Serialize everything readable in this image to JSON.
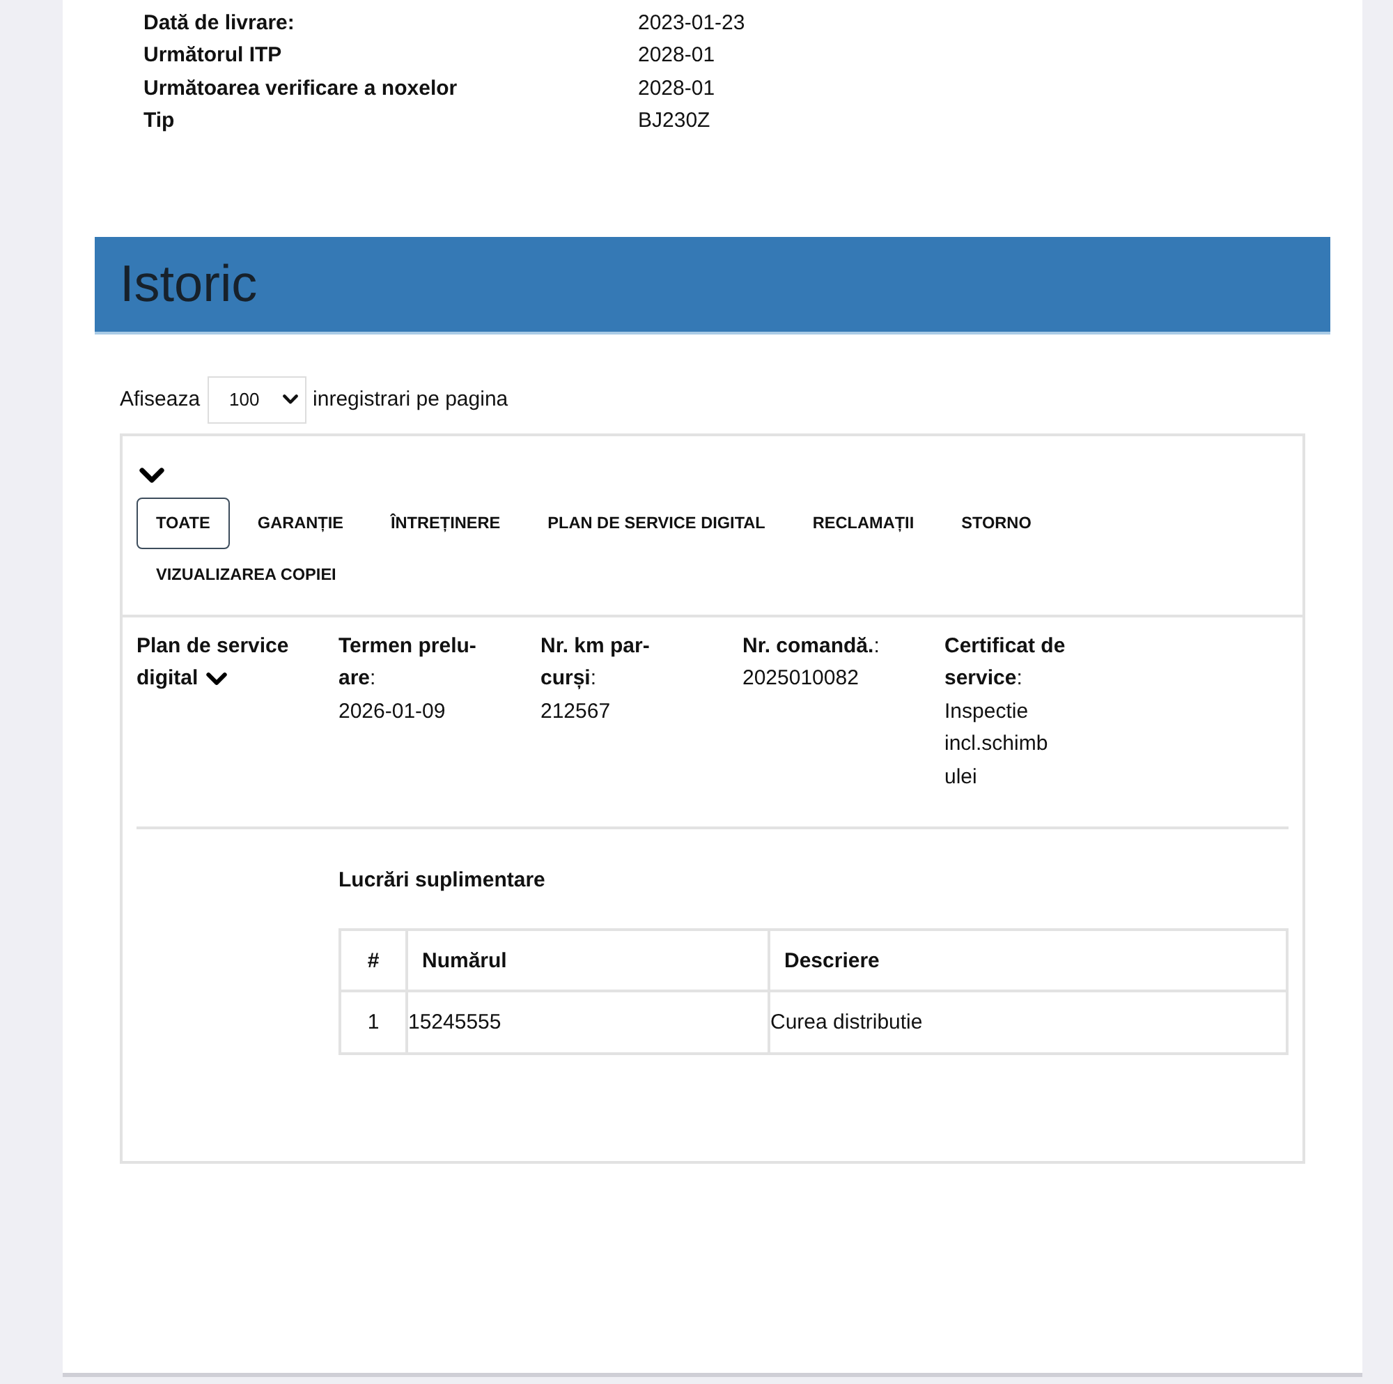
{
  "vehicle_info": [
    {
      "label": "Dată de livrare:",
      "value": "2023-01-23"
    },
    {
      "label": "Următorul ITP",
      "value": "2028-01"
    },
    {
      "label": "Următoarea verificare a noxelor",
      "value": "2028-01"
    },
    {
      "label": "Tip",
      "value": "BJ230Z"
    }
  ],
  "history": {
    "title": "Istoric",
    "page_size": {
      "prefix": "Afiseaza",
      "value": "100",
      "suffix": "inregistrari pe pagina"
    },
    "filter_tabs": [
      {
        "label": "TOATE",
        "selected": true
      },
      {
        "label": "GARANȚIE",
        "selected": false
      },
      {
        "label": "ÎNTREȚINERE",
        "selected": false
      },
      {
        "label": "PLAN DE SERVICE DIGITAL",
        "selected": false
      },
      {
        "label": "RECLAMAȚII",
        "selected": false
      },
      {
        "label": "STORNO",
        "selected": false
      },
      {
        "label": "VIZUALIZAREA COPIEI",
        "selected": false
      }
    ],
    "records": [
      {
        "type": "Plan de service digital",
        "expanded": true,
        "fields": [
          {
            "label": "**Termen prelu-are**:",
            "value": "2026-01-09"
          },
          {
            "label": "**Nr. km par-curși**:",
            "value": "212567"
          },
          {
            "label": "**Nr. comandă.**:",
            "value": "2025010082"
          },
          {
            "label": "**Certificat de service**:",
            "value": "Inspectie incl.schimb ulei"
          }
        ],
        "additional_work": {
          "title": "Lucrări suplimentare",
          "columns": [
            "#",
            "Numărul",
            "Descriere"
          ],
          "rows": [
            [
              "1",
              "15245555",
              "Curea distributie"
            ]
          ]
        }
      }
    ]
  }
}
